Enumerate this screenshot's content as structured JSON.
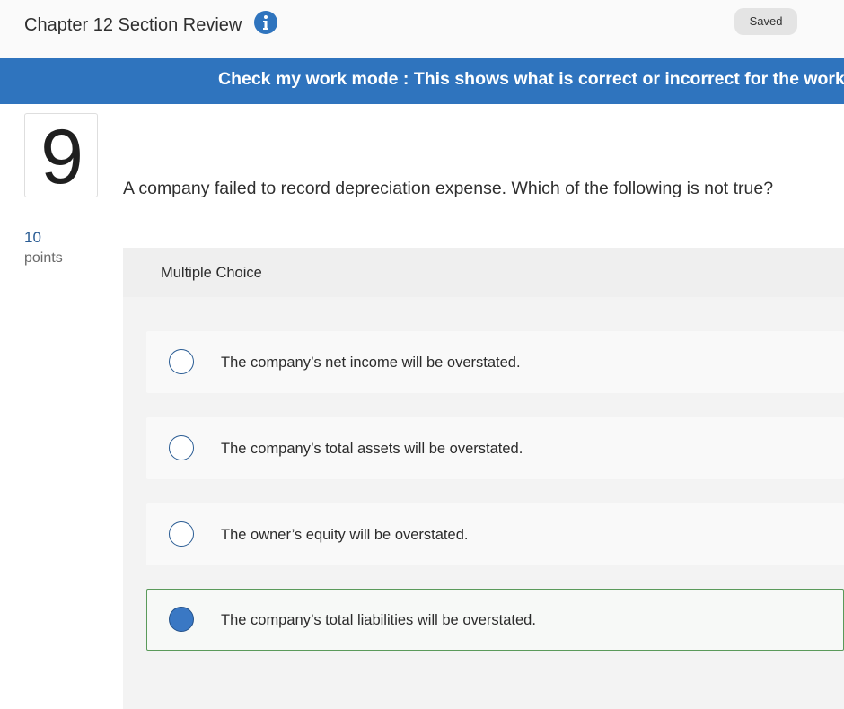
{
  "header": {
    "title": "Chapter 12 Section Review",
    "info_icon": "info-circle-icon",
    "saved_label": "Saved"
  },
  "banner": {
    "text": "Check my work mode : This shows what is correct or incorrect for the work you have completed so far."
  },
  "question": {
    "number": "9",
    "points_value": "10",
    "points_label": "points",
    "text": "A company failed to record depreciation expense. Which of the following is not true?"
  },
  "answer_panel": {
    "type_label": "Multiple Choice",
    "choices": [
      {
        "label": "The company’s net income will be overstated.",
        "selected": false
      },
      {
        "label": "The company’s total assets will be overstated.",
        "selected": false
      },
      {
        "label": "The owner’s equity will be overstated.",
        "selected": false
      },
      {
        "label": "The company’s total liabilities will be overstated.",
        "selected": true
      }
    ]
  },
  "colors": {
    "banner": "#2f74be",
    "radio_selected": "#3a78c4",
    "selected_border": "#5a9a5a"
  }
}
